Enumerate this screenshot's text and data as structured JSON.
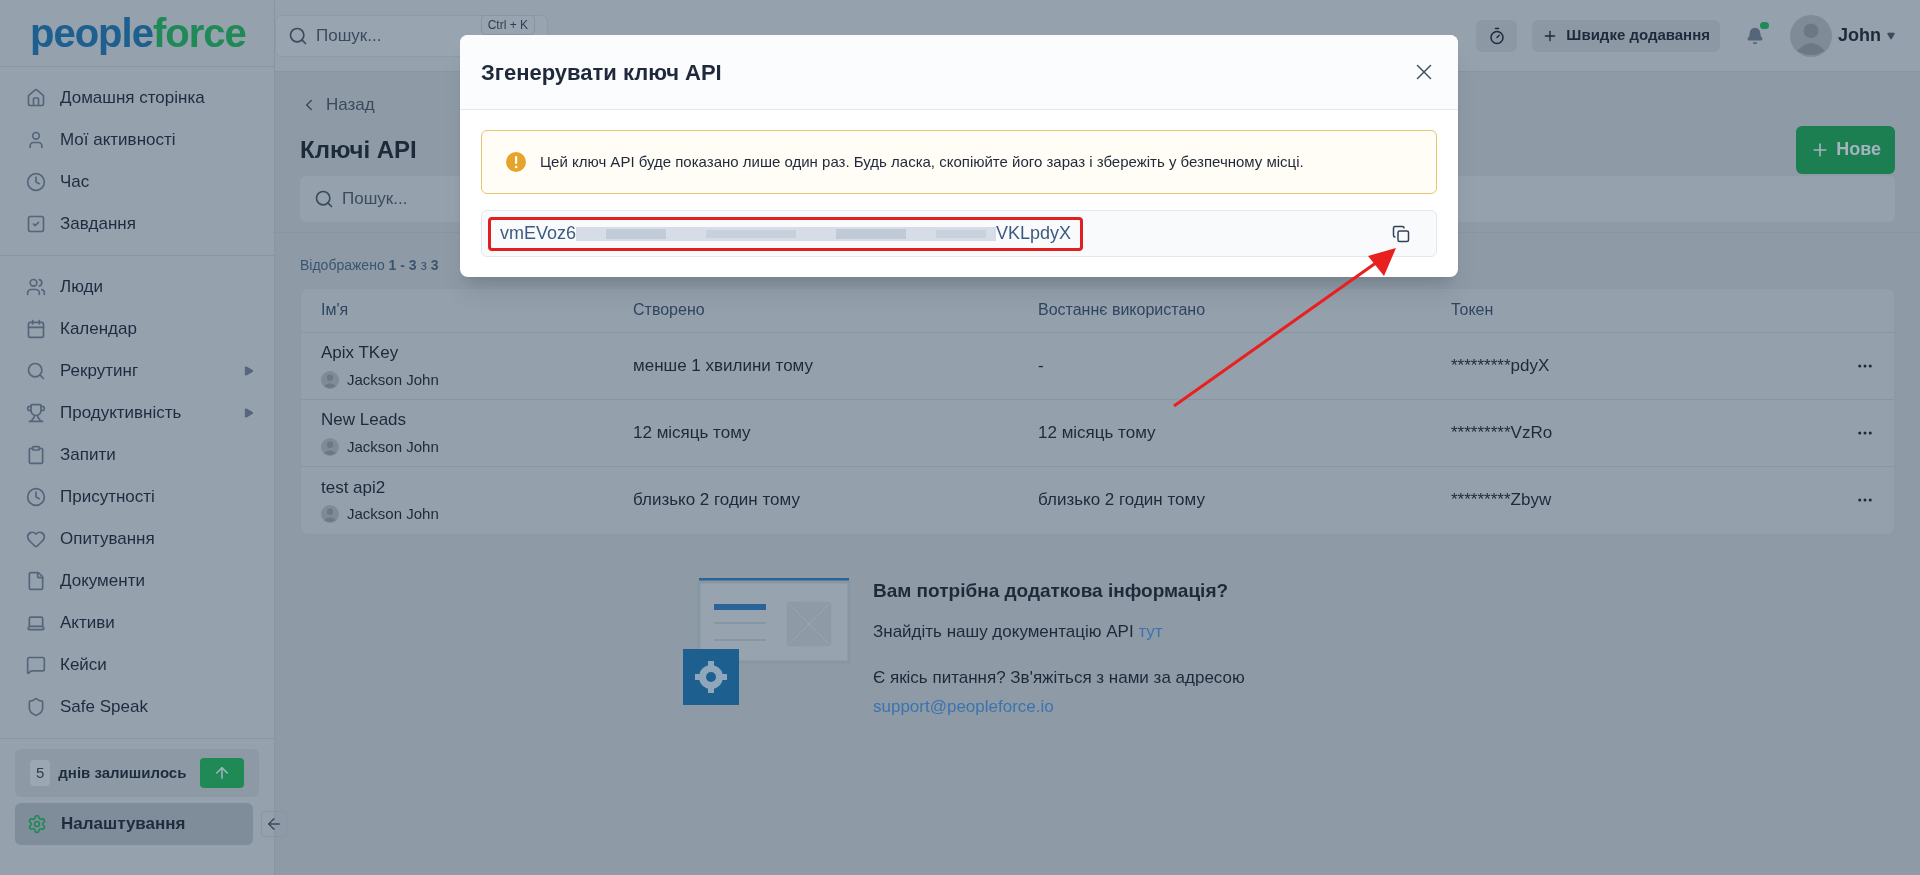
{
  "logo": {
    "part_1": "people",
    "part_2": "force"
  },
  "header": {
    "search_placeholder": "Пошук...",
    "shortcut": "Ctrl + K",
    "quick_add": "Швидке додавання",
    "has_unread": true,
    "user": "John"
  },
  "sidebar": {
    "groups": [
      [
        {
          "label": "Домашня сторінка",
          "has_submenu": false
        },
        {
          "label": "Мої активності",
          "has_submenu": false
        },
        {
          "label": "Час",
          "has_submenu": false
        },
        {
          "label": "Завдання",
          "has_submenu": false
        }
      ],
      [
        {
          "label": "Люди",
          "has_submenu": false
        },
        {
          "label": "Календар",
          "has_submenu": false
        },
        {
          "label": "Рекрутинг",
          "has_submenu": true
        },
        {
          "label": "Продуктивність",
          "has_submenu": true
        },
        {
          "label": "Запити",
          "has_submenu": false
        },
        {
          "label": "Присутності",
          "has_submenu": false
        },
        {
          "label": "Опитування",
          "has_submenu": false
        },
        {
          "label": "Документи",
          "has_submenu": false
        },
        {
          "label": "Активи",
          "has_submenu": false
        },
        {
          "label": "Кейси",
          "has_submenu": false
        },
        {
          "label": "Safe Speak",
          "has_submenu": false
        }
      ]
    ],
    "trial": {
      "days": "5",
      "label": "днів залишилось"
    },
    "settings": {
      "label": "Налаштування",
      "selected": true
    }
  },
  "main": {
    "back": "Назад",
    "title": "Ключі API",
    "new_button": "Нове",
    "search_placeholder": "Пошук...",
    "summary": "Відображено **1 - 3** з **3**",
    "table": {
      "columns": [
        "Ім'я",
        "Створено",
        "Востаннє використано",
        "Токен"
      ],
      "rows": [
        {
          "name": "Apix TKey",
          "owner": "Jackson John",
          "created": "менше 1 хвилини тому",
          "last_used": "-",
          "token": "*********pdyX"
        },
        {
          "name": "New Leads",
          "owner": "Jackson John",
          "created": "12 місяць тому",
          "last_used": "12 місяць тому",
          "token": "*********VzRo"
        },
        {
          "name": "test api2",
          "owner": "Jackson John",
          "created": "близько 2 годин тому",
          "last_used": "близько 2 годин тому",
          "token": "*********Zbyw"
        }
      ]
    },
    "info": {
      "title": "Вам потрібна додаткова інформація?",
      "doc_text": "Знайдіть нашу документацію API",
      "doc_link": "тут",
      "contact_text": "Є якісь питання? Зв'яжіться з нами за адресою",
      "email": "support@peopleforce.io"
    }
  },
  "modal": {
    "title": "Згенерувати ключ API",
    "warning": "Цей ключ API буде показано лише один раз. Будь ласка, скопіюйте його зараз і збережіть у безпечному місці.",
    "key_start": "vmEVoz6",
    "key_end": "VKLpdyX"
  }
}
